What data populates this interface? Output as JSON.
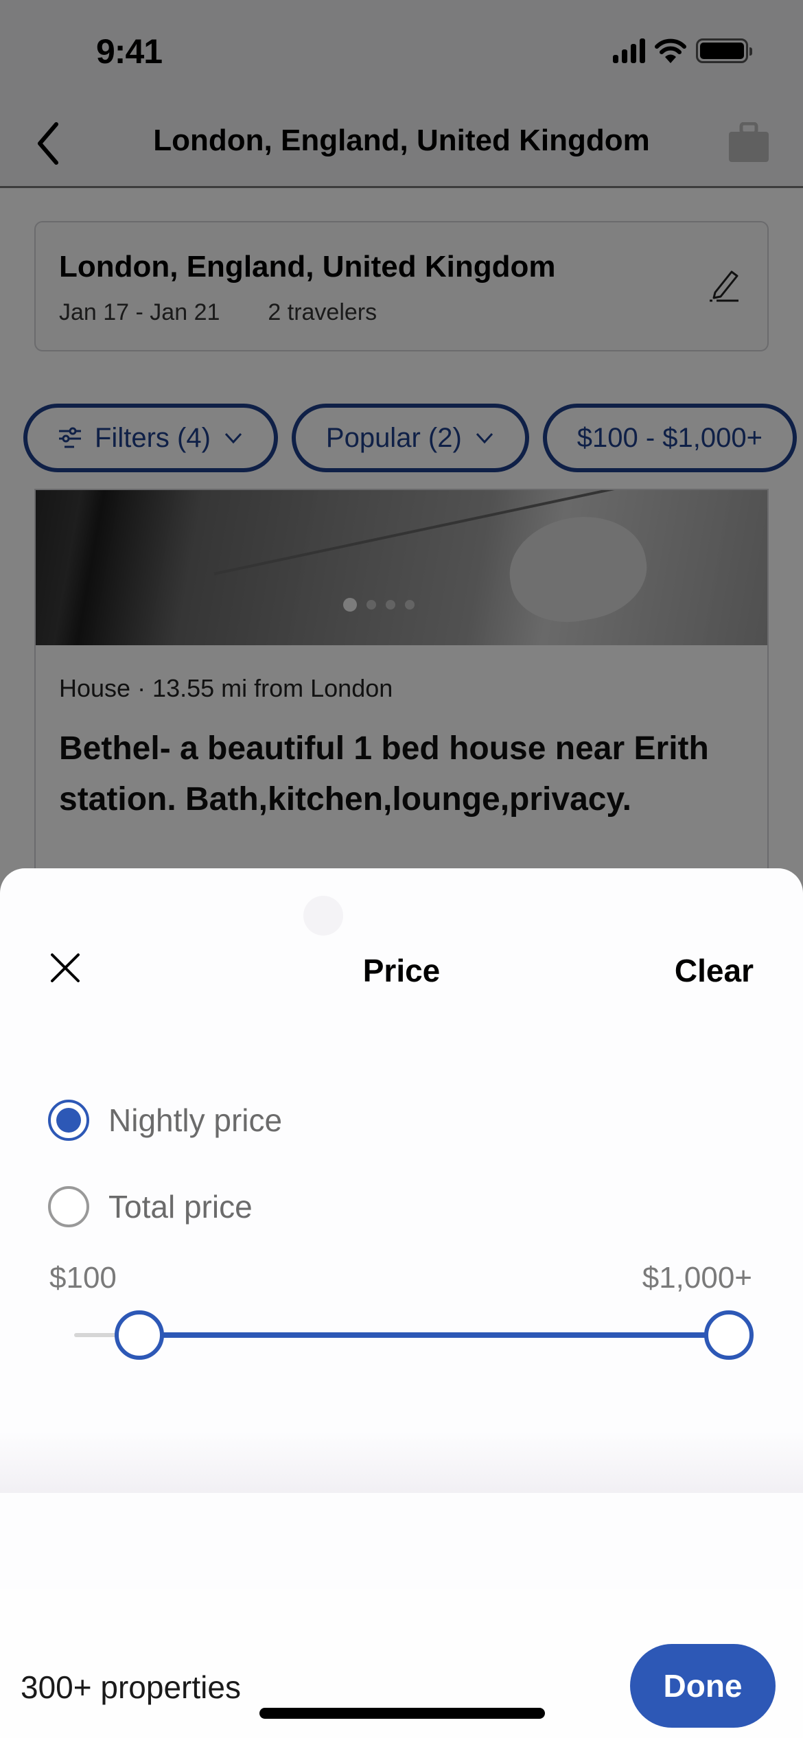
{
  "status_bar": {
    "time": "9:41",
    "icons": [
      "cellular-signal-icon",
      "wifi-icon",
      "battery-icon"
    ]
  },
  "nav": {
    "title": "London, England, United Kingdom",
    "back_icon": "chevron-left-icon",
    "trip_icon": "briefcase-icon"
  },
  "search_summary": {
    "destination": "London, England, United Kingdom",
    "dates": "Jan 17 - Jan 21",
    "travelers": "2 travelers",
    "edit_icon": "pencil-icon"
  },
  "filter_chips": [
    {
      "label": "Filters (4)",
      "icon": "sliders-icon",
      "has_dropdown": true
    },
    {
      "label": "Popular (2)",
      "has_dropdown": true
    },
    {
      "label": "$100 - $1,000+",
      "has_dropdown": false
    }
  ],
  "listing": {
    "photo_count": 4,
    "active_photo": 1,
    "meta": "House · 13.55 mi from London",
    "title": "Bethel- a beautiful 1 bed house near Erith station. Bath,kitchen,lounge,privacy."
  },
  "price_sheet": {
    "title": "Price",
    "close_icon": "close-icon",
    "clear_label": "Clear",
    "options": [
      {
        "label": "Nightly price",
        "selected": true
      },
      {
        "label": "Total price",
        "selected": false
      }
    ],
    "range": {
      "min_label": "$100",
      "max_label": "$1,000+",
      "low_value_fraction": 0.1,
      "high_value_fraction": 1.0
    },
    "result_count": "300+ properties",
    "done_label": "Done"
  },
  "colors": {
    "accent": "#2d58b6",
    "chip_border": "#1f3f8c",
    "overlay": "rgba(0,0,0,0.49)"
  }
}
